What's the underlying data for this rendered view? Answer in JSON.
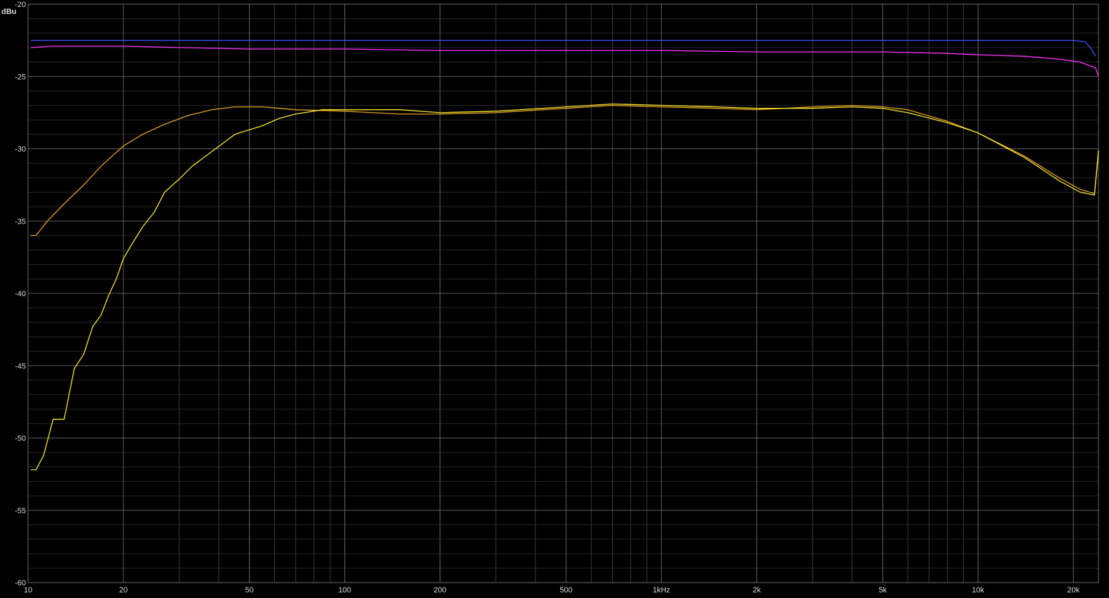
{
  "chart_data": {
    "type": "line",
    "ylabel": "dBu",
    "xscale": "log",
    "xlim": [
      10,
      24000
    ],
    "ylim": [
      -60,
      -20
    ],
    "grid": true,
    "x_ticks": [
      {
        "v": 10,
        "label": "10"
      },
      {
        "v": 20,
        "label": "20"
      },
      {
        "v": 50,
        "label": "50"
      },
      {
        "v": 100,
        "label": "100"
      },
      {
        "v": 200,
        "label": "200"
      },
      {
        "v": 500,
        "label": "500"
      },
      {
        "v": 1000,
        "label": "1kHz"
      },
      {
        "v": 2000,
        "label": "2k"
      },
      {
        "v": 5000,
        "label": "5k"
      },
      {
        "v": 10000,
        "label": "10k"
      },
      {
        "v": 20000,
        "label": "20k"
      }
    ],
    "y_ticks": [
      {
        "v": -20,
        "label": "-20"
      },
      {
        "v": -25,
        "label": "-25"
      },
      {
        "v": -30,
        "label": "-30"
      },
      {
        "v": -35,
        "label": "-35"
      },
      {
        "v": -40,
        "label": "-40"
      },
      {
        "v": -45,
        "label": "-45"
      },
      {
        "v": -50,
        "label": "-50"
      },
      {
        "v": -55,
        "label": "-55"
      },
      {
        "v": -60,
        "label": "-60"
      }
    ],
    "series": [
      {
        "color": "#3a52ff",
        "points": [
          [
            10.2,
            -22.5
          ],
          [
            20,
            -22.5
          ],
          [
            50,
            -22.5
          ],
          [
            100,
            -22.5
          ],
          [
            500,
            -22.5
          ],
          [
            1000,
            -22.5
          ],
          [
            5000,
            -22.5
          ],
          [
            10000,
            -22.5
          ],
          [
            20000,
            -22.5
          ],
          [
            21800,
            -22.6
          ],
          [
            22600,
            -23.0
          ],
          [
            23500,
            -23.6
          ]
        ]
      },
      {
        "color": "#ff33ff",
        "points": [
          [
            10.2,
            -23.0
          ],
          [
            12,
            -22.9
          ],
          [
            15,
            -22.9
          ],
          [
            20,
            -22.9
          ],
          [
            30,
            -23.0
          ],
          [
            50,
            -23.1
          ],
          [
            100,
            -23.1
          ],
          [
            200,
            -23.2
          ],
          [
            500,
            -23.2
          ],
          [
            1000,
            -23.2
          ],
          [
            2000,
            -23.3
          ],
          [
            5000,
            -23.3
          ],
          [
            8000,
            -23.4
          ],
          [
            10000,
            -23.5
          ],
          [
            14000,
            -23.6
          ],
          [
            18000,
            -23.8
          ],
          [
            21000,
            -24.0
          ],
          [
            23500,
            -24.4
          ],
          [
            24000,
            -25.0
          ]
        ]
      },
      {
        "color": "#e3a020",
        "points": [
          [
            10.2,
            -36.0
          ],
          [
            10.6,
            -36.0
          ],
          [
            11.5,
            -35.0
          ],
          [
            13,
            -33.8
          ],
          [
            15,
            -32.5
          ],
          [
            17,
            -31.2
          ],
          [
            20,
            -29.8
          ],
          [
            23,
            -29.0
          ],
          [
            27,
            -28.3
          ],
          [
            32,
            -27.7
          ],
          [
            38,
            -27.3
          ],
          [
            45,
            -27.1
          ],
          [
            55,
            -27.1
          ],
          [
            70,
            -27.3
          ],
          [
            100,
            -27.4
          ],
          [
            150,
            -27.6
          ],
          [
            200,
            -27.6
          ],
          [
            300,
            -27.5
          ],
          [
            500,
            -27.2
          ],
          [
            700,
            -27.0
          ],
          [
            1000,
            -27.1
          ],
          [
            1500,
            -27.2
          ],
          [
            2000,
            -27.3
          ],
          [
            3000,
            -27.1
          ],
          [
            4000,
            -27.0
          ],
          [
            5000,
            -27.1
          ],
          [
            6000,
            -27.3
          ],
          [
            8000,
            -28.1
          ],
          [
            10000,
            -28.9
          ],
          [
            14000,
            -30.5
          ],
          [
            18000,
            -32.0
          ],
          [
            21000,
            -32.8
          ],
          [
            23300,
            -33.1
          ],
          [
            24000,
            -30.4
          ]
        ]
      },
      {
        "color": "#f5e62a",
        "points": [
          [
            10.2,
            -52.2
          ],
          [
            10.6,
            -52.2
          ],
          [
            11.2,
            -51.2
          ],
          [
            12,
            -48.7
          ],
          [
            13,
            -48.7
          ],
          [
            14,
            -45.2
          ],
          [
            15,
            -44.2
          ],
          [
            16,
            -42.3
          ],
          [
            17,
            -41.5
          ],
          [
            18,
            -40.1
          ],
          [
            19,
            -39.0
          ],
          [
            20,
            -37.6
          ],
          [
            21,
            -36.8
          ],
          [
            23,
            -35.4
          ],
          [
            25,
            -34.4
          ],
          [
            27,
            -33.0
          ],
          [
            30,
            -32.1
          ],
          [
            33,
            -31.2
          ],
          [
            38,
            -30.2
          ],
          [
            45,
            -29.0
          ],
          [
            55,
            -28.4
          ],
          [
            62,
            -27.9
          ],
          [
            70,
            -27.6
          ],
          [
            85,
            -27.3
          ],
          [
            100,
            -27.3
          ],
          [
            150,
            -27.3
          ],
          [
            200,
            -27.5
          ],
          [
            300,
            -27.4
          ],
          [
            500,
            -27.1
          ],
          [
            700,
            -26.9
          ],
          [
            1000,
            -27.0
          ],
          [
            1500,
            -27.1
          ],
          [
            2000,
            -27.2
          ],
          [
            3000,
            -27.2
          ],
          [
            4000,
            -27.1
          ],
          [
            5000,
            -27.2
          ],
          [
            6000,
            -27.5
          ],
          [
            8000,
            -28.2
          ],
          [
            10000,
            -28.9
          ],
          [
            14000,
            -30.6
          ],
          [
            18000,
            -32.2
          ],
          [
            21000,
            -33.0
          ],
          [
            23300,
            -33.2
          ],
          [
            24000,
            -30.1
          ]
        ]
      }
    ]
  }
}
